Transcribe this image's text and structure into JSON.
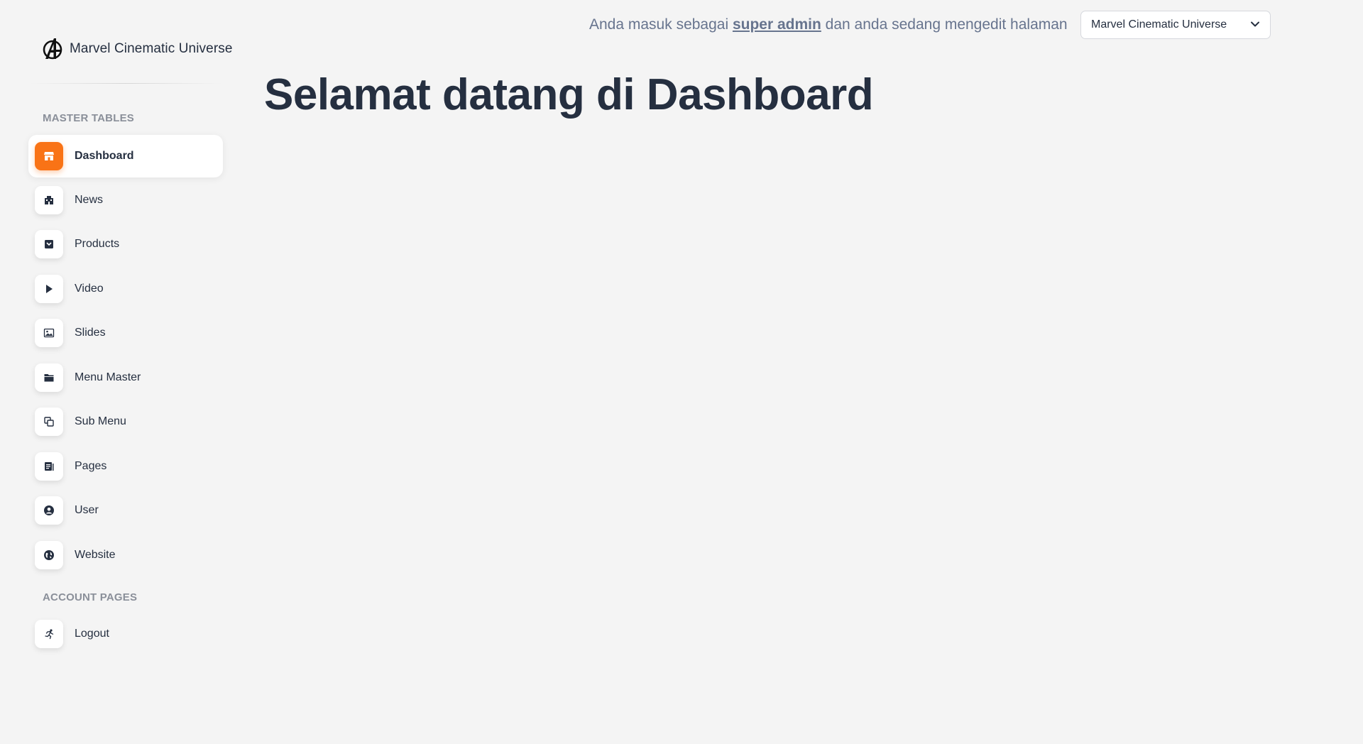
{
  "brand": {
    "name": "Marvel Cinematic Universe",
    "logo_icon": "avengers-logo"
  },
  "sidebar": {
    "sections": [
      {
        "title": "MASTER TABLES"
      },
      {
        "title": "ACCOUNT PAGES"
      }
    ],
    "items": [
      {
        "label": "Dashboard",
        "icon": "shop-icon",
        "active": true
      },
      {
        "label": "News",
        "icon": "office-building-icon"
      },
      {
        "label": "Products",
        "icon": "box-icon"
      },
      {
        "label": "Video",
        "icon": "play-icon"
      },
      {
        "label": "Slides",
        "icon": "image-icon"
      },
      {
        "label": "Menu Master",
        "icon": "folder-icon"
      },
      {
        "label": "Sub Menu",
        "icon": "copy-icon"
      },
      {
        "label": "Pages",
        "icon": "document-icon"
      },
      {
        "label": "User",
        "icon": "user-circle-icon"
      },
      {
        "label": "Website",
        "icon": "globe-icon"
      },
      {
        "label": "Logout",
        "icon": "running-person-icon"
      }
    ]
  },
  "header": {
    "login_prefix": "Anda masuk sebagai ",
    "role": "super admin",
    "login_suffix": " dan anda sedang mengedit halaman",
    "site_select_value": "Marvel Cinematic Universe"
  },
  "main": {
    "title": "Selamat datang di Dashboard"
  },
  "colors": {
    "accent": "#f97316",
    "background": "#f4f4f4",
    "text": "#252f40",
    "muted": "#67748e"
  }
}
